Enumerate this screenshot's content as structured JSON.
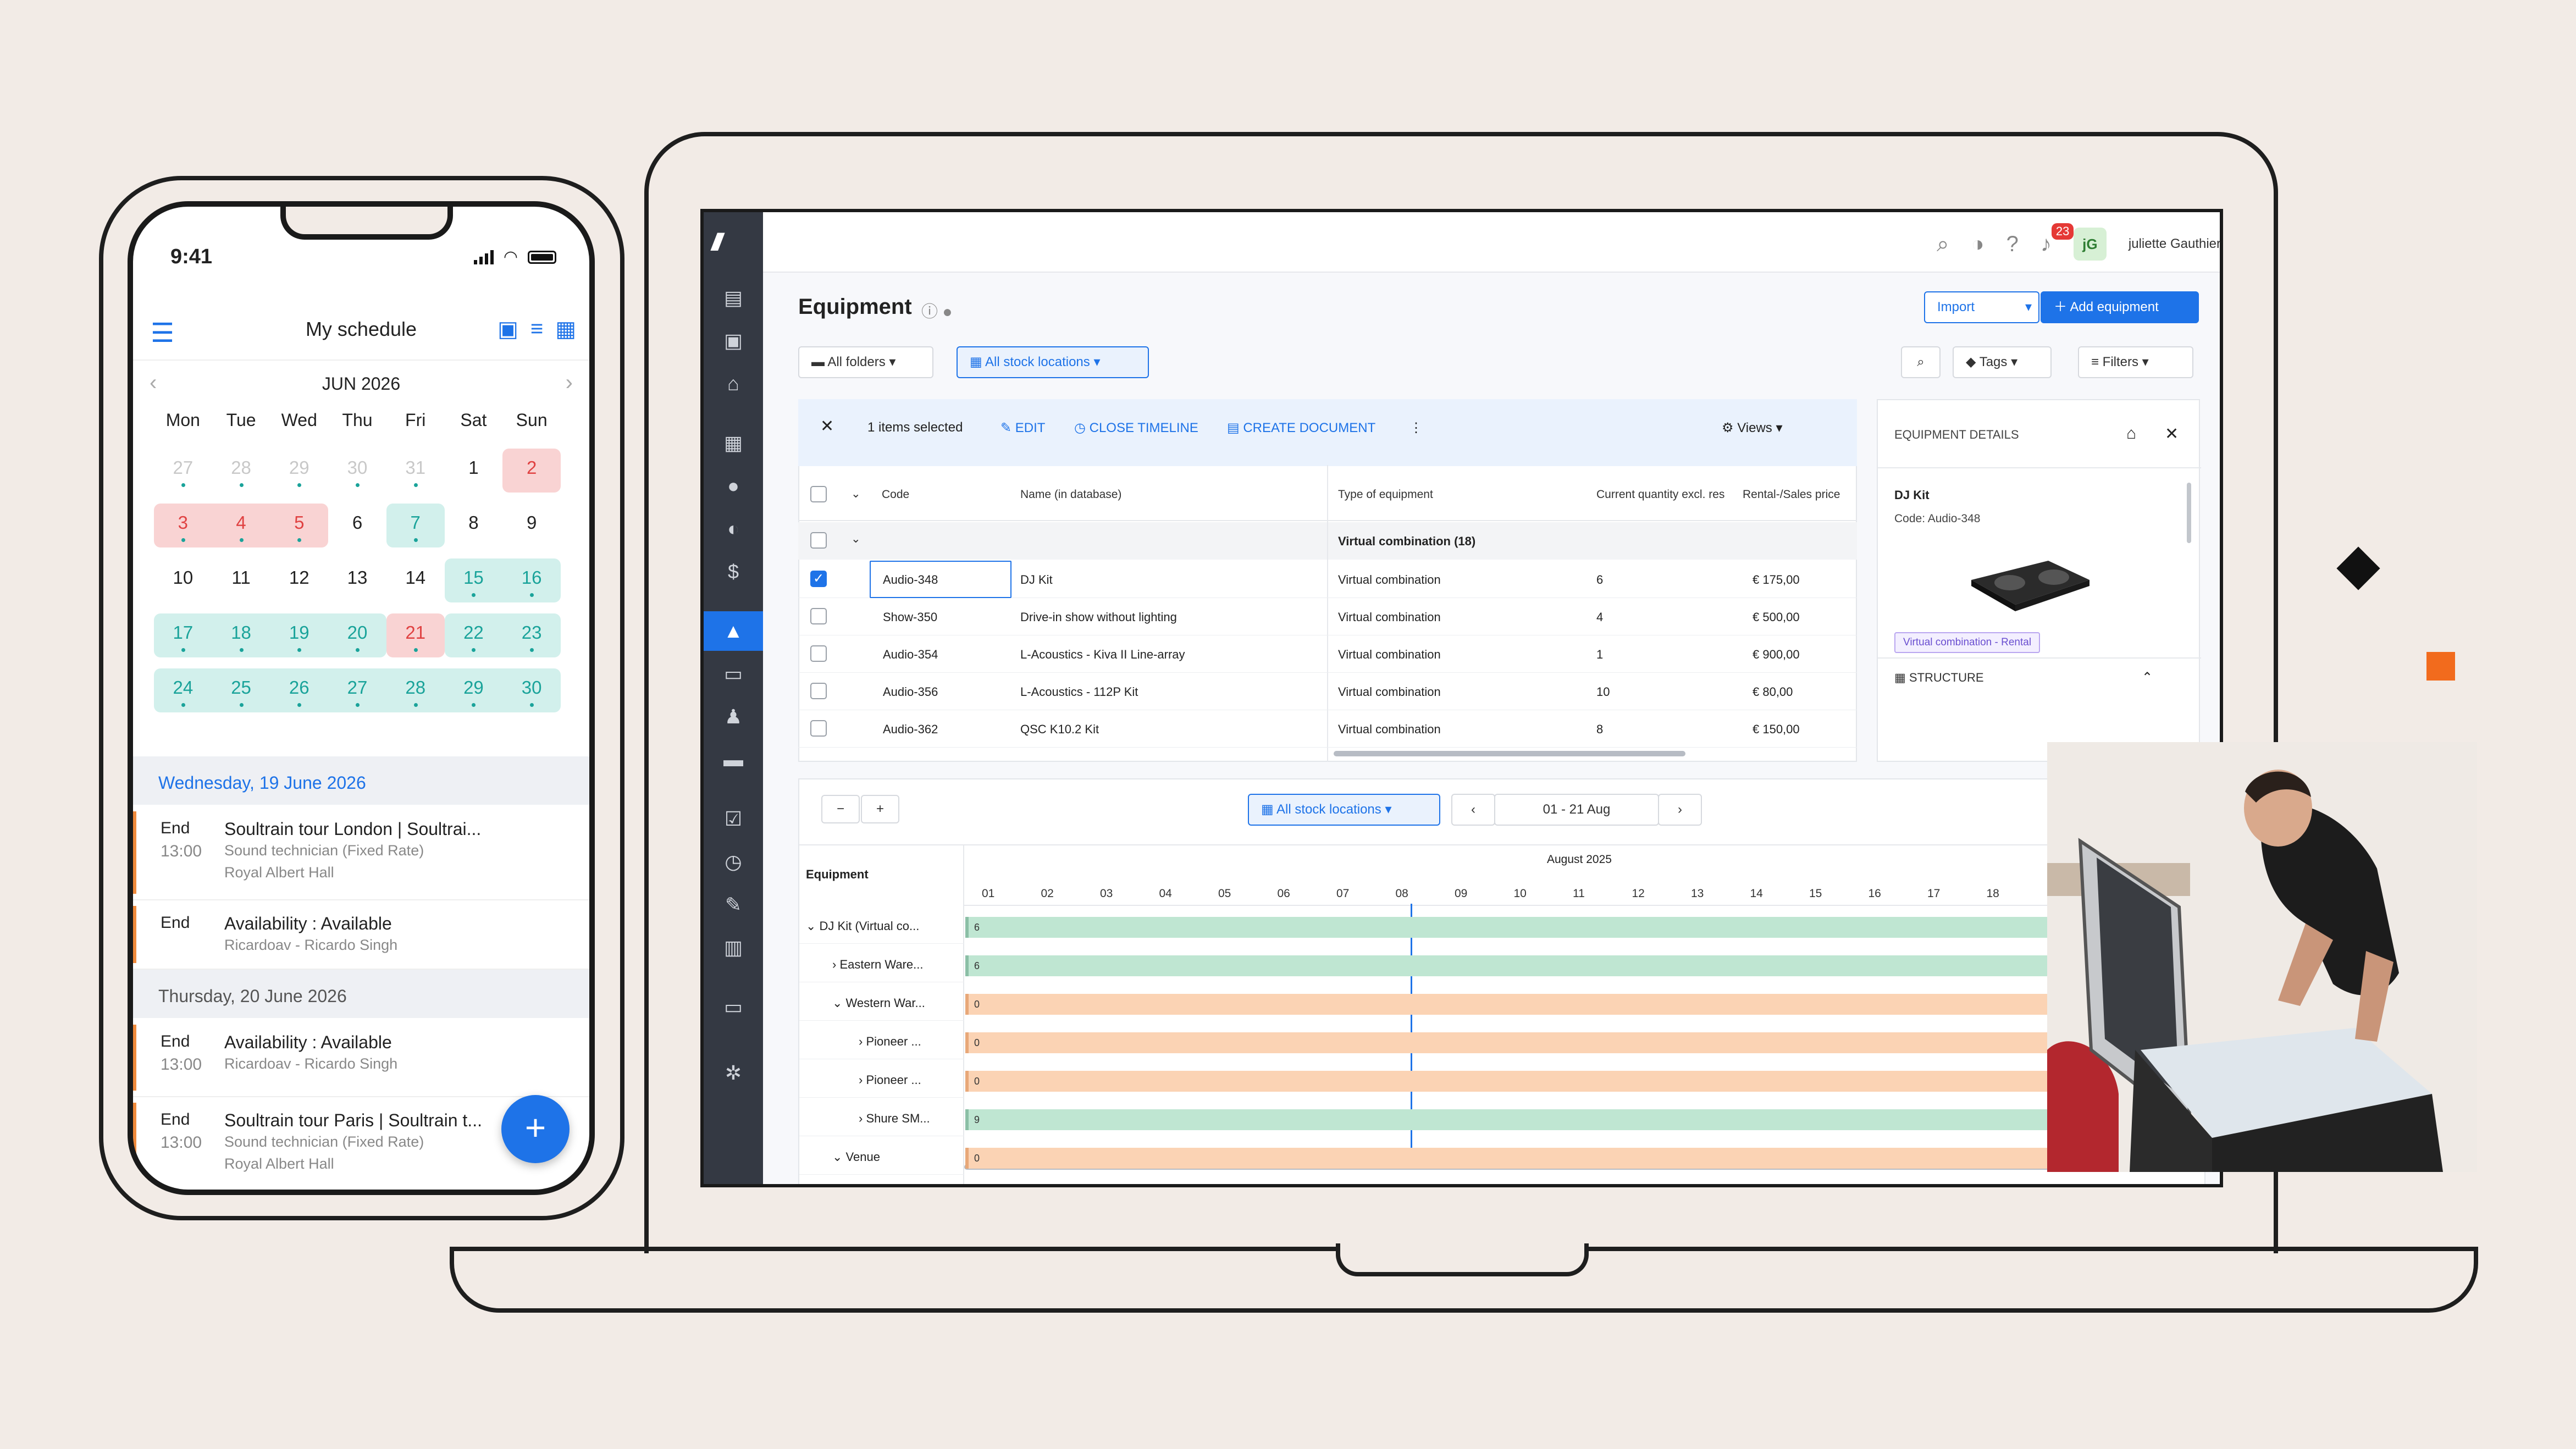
{
  "phone": {
    "time": "9:41",
    "title": "My schedule",
    "month": "JUN 2026",
    "weekdays": [
      "Mon",
      "Tue",
      "Wed",
      "Thu",
      "Fri",
      "Sat",
      "Sun"
    ],
    "days": [
      "27",
      "28",
      "29",
      "30",
      "31",
      "1",
      "2",
      "3",
      "4",
      "5",
      "6",
      "7",
      "8",
      "9",
      "10",
      "11",
      "12",
      "13",
      "14",
      "15",
      "16",
      "17",
      "18",
      "19",
      "20",
      "21",
      "22",
      "23",
      "24",
      "25",
      "26",
      "27",
      "28",
      "29",
      "30"
    ],
    "section1": "Wednesday, 19 June 2026",
    "section2": "Thursday, 20 June 2026",
    "events": [
      {
        "end": "End",
        "time": "13:00",
        "title": "Soultrain tour London | Soultrai...",
        "sub": "Sound technician (Fixed Rate)",
        "sub2": "Royal Albert Hall"
      },
      {
        "end": "End",
        "time": "",
        "title": "Availability : Available",
        "sub": "Ricardoav - Ricardo Singh",
        "sub2": ""
      },
      {
        "end": "End",
        "time": "13:00",
        "title": "Availability : Available",
        "sub": "Ricardoav - Ricardo Singh",
        "sub2": ""
      },
      {
        "end": "End",
        "time": "13:00",
        "title": "Soultrain tour Paris | Soultrain t...",
        "sub": "Sound technician (Fixed Rate)",
        "sub2": "Royal Albert Hall"
      }
    ],
    "fab": "+"
  },
  "app": {
    "notif_count": "23",
    "avatar": "jG",
    "user": "juliette Gauthier",
    "title": "Equipment",
    "import": "Import",
    "add": "Add equipment",
    "all_folders": "All folders",
    "all_stock": "All stock locations",
    "tags": "Tags",
    "filters": "Filters",
    "selected": "1 items selected",
    "edit": "EDIT",
    "close_timeline": "CLOSE TIMELINE",
    "create_doc": "CREATE DOCUMENT",
    "views": "Views",
    "columns": [
      "Code",
      "Name (in database)",
      "Type of equipment",
      "Current quantity excl. res",
      "Rental-/Sales price"
    ],
    "group": "Virtual combination (18)",
    "rows": [
      {
        "code": "Audio-348",
        "name": "DJ Kit",
        "type": "Virtual combination",
        "qty": "6",
        "price": "€ 175,00",
        "checked": true
      },
      {
        "code": "Show-350",
        "name": "Drive-in show without lighting",
        "type": "Virtual combination",
        "qty": "4",
        "price": "€ 500,00",
        "checked": false
      },
      {
        "code": "Audio-354",
        "name": "L-Acoustics - Kiva II Line-array",
        "type": "Virtual combination",
        "qty": "1",
        "price": "€ 900,00",
        "checked": false
      },
      {
        "code": "Audio-356",
        "name": "L-Acoustics - 112P Kit",
        "type": "Virtual combination",
        "qty": "10",
        "price": "€ 80,00",
        "checked": false
      },
      {
        "code": "Audio-362",
        "name": "QSC K10.2 Kit",
        "type": "Virtual combination",
        "qty": "8",
        "price": "€ 150,00",
        "checked": false
      }
    ],
    "details": {
      "header": "EQUIPMENT DETAILS",
      "name": "DJ Kit",
      "code": "Code: Audio-348",
      "tag": "Virtual combination - Rental",
      "structure": "STRUCTURE"
    },
    "timeline": {
      "minus": "−",
      "plus": "+",
      "stock": "All stock locations",
      "range": "01 - 21 Aug",
      "equipment_label": "Equipment",
      "month": "August 2025",
      "days": [
        "01",
        "02",
        "03",
        "04",
        "05",
        "06",
        "07",
        "08",
        "09",
        "10",
        "11",
        "12",
        "13",
        "14",
        "15",
        "16",
        "17",
        "18"
      ],
      "rows": [
        {
          "label": "DJ Kit (Virtual co...",
          "val": "6",
          "color": "#bfe6d2"
        },
        {
          "label": "Eastern Ware...",
          "val": "6",
          "color": "#bfe6d2"
        },
        {
          "label": "Western War...",
          "val": "0",
          "color": "#fbd3b4"
        },
        {
          "label": "Pioneer ...",
          "val": "0",
          "color": "#fbd3b4"
        },
        {
          "label": "Pioneer ...",
          "val": "0",
          "color": "#fbd3b4"
        },
        {
          "label": "Shure SM...",
          "val": "9",
          "color": "#bfe6d2"
        },
        {
          "label": "Venue",
          "val": "0",
          "color": "#fbd3b4"
        }
      ]
    }
  }
}
